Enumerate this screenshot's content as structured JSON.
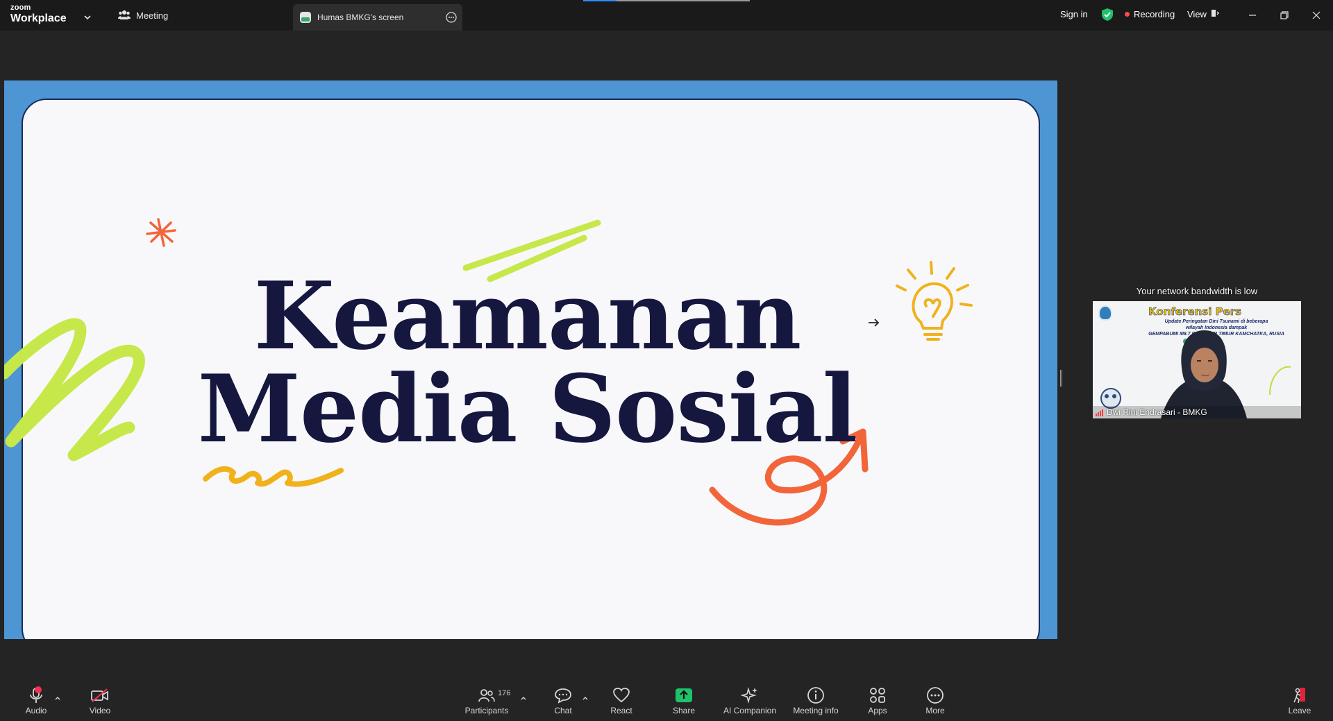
{
  "titlebar": {
    "brand_small": "zoom",
    "brand_big": "Workplace",
    "meeting_label": "Meeting",
    "screen_tab_label": "Humas BMKG's screen",
    "sign_in": "Sign in",
    "recording": "Recording",
    "view": "View"
  },
  "slide": {
    "line1": "Keamanan",
    "line2": "Media Sosial"
  },
  "participant": {
    "bandwidth_notice": "Your network bandwidth is low",
    "name": "Dwi Rini Endrasari - BMKG",
    "shared_title": "Konferensi Pers",
    "shared_sub1": "Update Peringatan Dini Tsunami di beberapa",
    "shared_sub2": "wilayah Indonesia dampak",
    "shared_sub3": "GEMPABUMI M8.7 DI PESISIR TIMUR KAMCHATKA, RUSIA"
  },
  "toolbar": {
    "audio": "Audio",
    "video": "Video",
    "participants": "Participants",
    "participants_count": "176",
    "chat": "Chat",
    "react": "React",
    "share": "Share",
    "ai_companion": "AI Companion",
    "meeting_info": "Meeting info",
    "apps": "Apps",
    "more": "More",
    "leave": "Leave"
  },
  "colors": {
    "slide_frame": "#4d96d3",
    "slide_title": "#15173e",
    "doodle_green": "#c7e84a",
    "doodle_orange": "#f2653a",
    "doodle_yellow": "#f0b21c",
    "share_green": "#1fc16b",
    "recording_red": "#ff4a4a"
  }
}
